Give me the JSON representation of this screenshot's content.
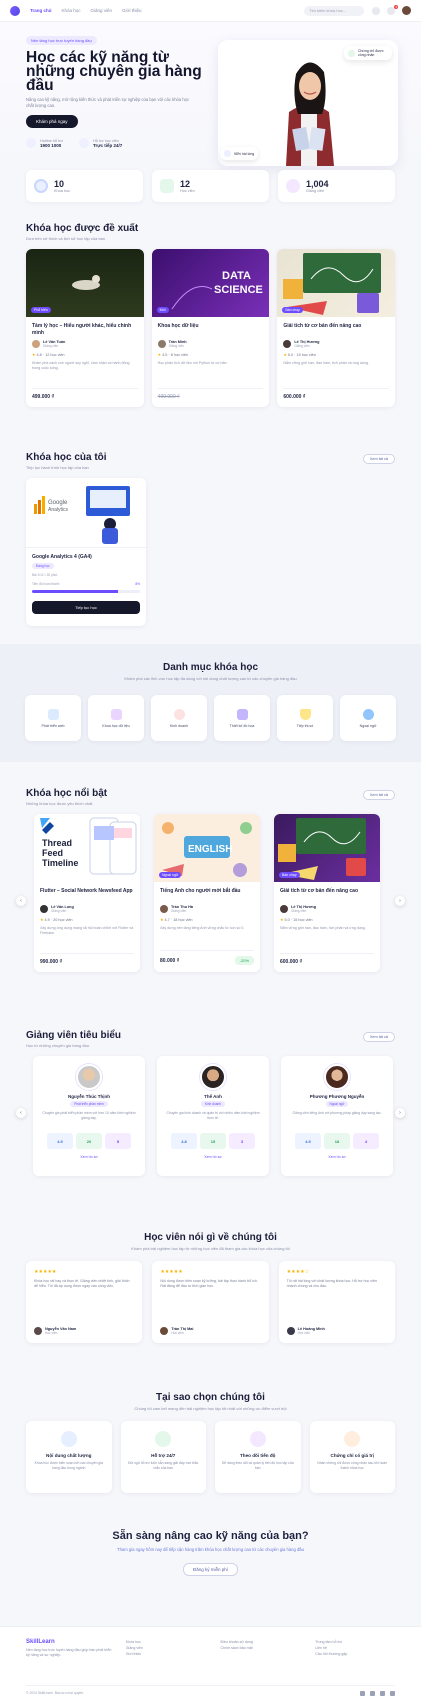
{
  "nav": {
    "links": [
      "Trang chủ",
      "Khóa học",
      "Giảng viên",
      "Giới thiệu"
    ],
    "search_placeholder": "Tìm kiếm khóa học...",
    "notification_count": "3"
  },
  "hero": {
    "pill": "Nền tảng học trực tuyến hàng đầu",
    "title": "Học các kỹ năng từ những chuyên gia hàng đầu",
    "subtitle": "Nâng cao kỹ năng, mở rộng kiến thức và phát triển sự nghiệp của bạn với các khóa học chất lượng cao.",
    "cta": "Khám phá ngay",
    "mini": [
      {
        "label": "Hotline hỗ trợ",
        "value": "1900 1000"
      },
      {
        "label": "Hỗ trợ học viên",
        "value": "Trực tiếp 24/7"
      }
    ],
    "badge_top": "Chứng chỉ được công nhận",
    "badge_bottom": "98% hài lòng"
  },
  "stats": [
    {
      "value": "10",
      "label": "Khóa học"
    },
    {
      "value": "12",
      "label": "Học viên"
    },
    {
      "value": "1,004",
      "label": "Giảng viên"
    }
  ],
  "recommended": {
    "title": "Khóa học được đề xuất",
    "subtitle": "Dựa trên sở thích và lịch sử học tập của bạn",
    "courses": [
      {
        "tag": "Phổ biến",
        "title": "Tâm lý học – Hiểu người khác, hiểu chính mình",
        "author": "Lê Văn Tuấn",
        "role": "Giảng viên",
        "rating": "4.8",
        "learners": "12 học viên",
        "desc": "Khám phá cách con người suy nghĩ, cảm nhận và hành động trong cuộc sống.",
        "price": "499.000 ₫",
        "old": ""
      },
      {
        "tag": "Mới",
        "title": "Khoa học dữ liệu",
        "author": "Trần Minh",
        "role": "Giảng viên",
        "rating": "4.5",
        "learners": "8 học viên",
        "desc": "Học phân tích dữ liệu với Python từ cơ bản.",
        "price": "",
        "old": "499.000 ₫"
      },
      {
        "tag": "Bán chạy",
        "title": "Giải tích từ cơ bản đến nâng cao",
        "author": "Lê Thị Hương",
        "role": "Giảng viên",
        "rating": "5.0",
        "learners": "15 học viên",
        "desc": "Nắm vững giới hạn, đạo hàm, tích phân và ứng dụng.",
        "price": "600.000 ₫",
        "old": ""
      }
    ]
  },
  "my_courses": {
    "title": "Khóa học của tôi",
    "subtitle": "Tiếp tục hành trình học tập của bạn",
    "see_all": "Xem tất cả",
    "course": {
      "title": "Google Analytics 4 (GA4)",
      "tag": "Đang học",
      "progress_label": "Tiến độ hoàn thành",
      "progress": 0.8,
      "progress_text": "8%",
      "lessons": "Bài 1/12 • 30 phút",
      "button": "Tiếp tục học",
      "logo_text": "Google Analytics"
    }
  },
  "categories": {
    "title": "Danh mục khóa học",
    "subtitle": "Khám phá các lĩnh vực học tập đa dạng với nội dung chất lượng cao từ các chuyên gia hàng đầu",
    "items": [
      "Phát triển web",
      "Khoa học dữ liệu",
      "Kinh doanh",
      "Thiết kế đồ họa",
      "Tiếp thị số",
      "Ngoại ngữ"
    ]
  },
  "featured": {
    "title": "Khóa học nổi bật",
    "subtitle": "Những khóa học được yêu thích nhất",
    "see_all": "Xem tất cả",
    "courses": [
      {
        "tag": "Flutter",
        "title": "Flutter – Social Network Newsfeed App",
        "author": "Lê Văn Long",
        "role": "Giảng viên",
        "rating": "4.9",
        "learners": "20 học viên",
        "desc": "Xây dựng ứng dụng mạng xã hội hoàn chỉnh với Flutter và Firebase.",
        "price": "990.000 ₫",
        "badge": "",
        "thumb_text1": "Thread",
        "thumb_text2": "Feed",
        "thumb_text3": "Timeline"
      },
      {
        "tag": "Ngoại ngữ",
        "title": "Tiếng Anh cho người mới bắt đầu",
        "author": "Trần Thu Hà",
        "role": "Giảng viên",
        "rating": "4.7",
        "learners": "18 học viên",
        "desc": "Xây dựng nền tảng tiếng Anh vững chắc từ con số 0.",
        "price": "80.000 ₫",
        "badge": "-20%",
        "thumb_text1": "ENGLISH",
        "thumb_text2": "",
        "thumb_text3": ""
      },
      {
        "tag": "Bán chạy",
        "title": "Giải tích từ cơ bản đến nâng cao",
        "author": "Lê Thị Hương",
        "role": "Giảng viên",
        "rating": "5.0",
        "learners": "15 học viên",
        "desc": "Nắm vững giới hạn, đạo hàm, tích phân và ứng dụng.",
        "price": "600.000 ₫",
        "badge": "",
        "thumb_text1": "",
        "thumb_text2": "",
        "thumb_text3": ""
      }
    ]
  },
  "instructors": {
    "title": "Giảng viên tiêu biểu",
    "subtitle": "Học từ những chuyên gia hàng đầu",
    "see_all": "Xem tất cả",
    "items": [
      {
        "name": "Nguyễn Thúc Thịnh",
        "role": "Phát triển phần mềm",
        "desc": "Chuyên gia phát triển phần mềm với hơn 10 năm kinh nghiệm giảng dạy.",
        "s1": "4.9",
        "s2": "20",
        "s3": "5",
        "link": "Xem hồ sơ"
      },
      {
        "name": "Thế Anh",
        "role": "Kinh doanh",
        "desc": "Chuyên gia kinh doanh và quản trị với nhiều năm kinh nghiệm thực tế.",
        "s1": "4.8",
        "s2": "15",
        "s3": "3",
        "link": "Xem hồ sơ"
      },
      {
        "name": "Phương Phương Nguyễn",
        "role": "Ngoại ngữ",
        "desc": "Giảng viên tiếng Anh với phương pháp giảng dạy sáng tạo.",
        "s1": "4.9",
        "s2": "18",
        "s3": "4",
        "link": "Xem hồ sơ"
      }
    ]
  },
  "testimonials": {
    "title": "Học viên nói gì về chúng tôi",
    "subtitle": "Khám phá trải nghiệm học tập từ những học viên đã tham gia các khóa học của chúng tôi",
    "items": [
      {
        "stars": "★★★★★",
        "text": "Khóa học rất hay và thực tế. Giảng viên nhiệt tình, giải thích dễ hiểu. Tôi đã áp dụng được ngay vào công việc.",
        "name": "Nguyễn Văn Nam",
        "role": "Học viên"
      },
      {
        "stars": "★★★★★",
        "text": "Nội dung được biên soạn kỹ lưỡng, bài tập thực hành bổ ích. Rất đáng để đầu tư thời gian học.",
        "name": "Trần Thị Mai",
        "role": "Học viên"
      },
      {
        "stars": "★★★★☆",
        "text": "Tôi rất hài lòng với chất lượng khóa học. Hỗ trợ học viên nhanh chóng và chu đáo.",
        "name": "Lê Hoàng Minh",
        "role": "Học viên"
      }
    ]
  },
  "why": {
    "title": "Tại sao chọn chúng tôi",
    "subtitle": "Chúng tôi cam kết mang đến trải nghiệm học tập tốt nhất với những ưu điểm vượt trội",
    "items": [
      {
        "title": "Nội dung chất lượng",
        "desc": "Khóa học được biên soạn bởi các chuyên gia hàng đầu trong ngành"
      },
      {
        "title": "Hỗ trợ 24/7",
        "desc": "Đội ngũ hỗ trợ luôn sẵn sàng giải đáp mọi thắc mắc của bạn"
      },
      {
        "title": "Theo dõi tiến độ",
        "desc": "Dễ dàng theo dõi và quản lý tiến độ học tập của bạn"
      },
      {
        "title": "Chứng chỉ có giá trị",
        "desc": "Nhận chứng chỉ được công nhận sau khi hoàn thành khóa học"
      }
    ]
  },
  "cta": {
    "title": "Sẵn sàng nâng cao kỹ năng của bạn?",
    "subtitle": "Tham gia ngay hôm nay để tiếp cận hàng trăm khóa học chất lượng cao từ các chuyên gia hàng đầu",
    "button": "Đăng ký miễn phí"
  },
  "footer": {
    "brand": "SkillLearn",
    "about": "Nền tảng học trực tuyến hàng đầu giúp bạn phát triển kỹ năng và sự nghiệp.",
    "col1": [
      "Khóa học",
      "Giảng viên",
      "Giới thiệu"
    ],
    "col2": [
      "Điều khoản sử dụng",
      "Chính sách bảo mật"
    ],
    "col3": [
      "Trung tâm hỗ trợ",
      "Liên hệ",
      "Câu hỏi thường gặp"
    ],
    "copyright": "© 2024 SkillLearn. Bảo lưu mọi quyền."
  },
  "colors": {
    "accent": "#6d4cff",
    "dark": "#15172b",
    "bg": "#f6f7fb"
  }
}
